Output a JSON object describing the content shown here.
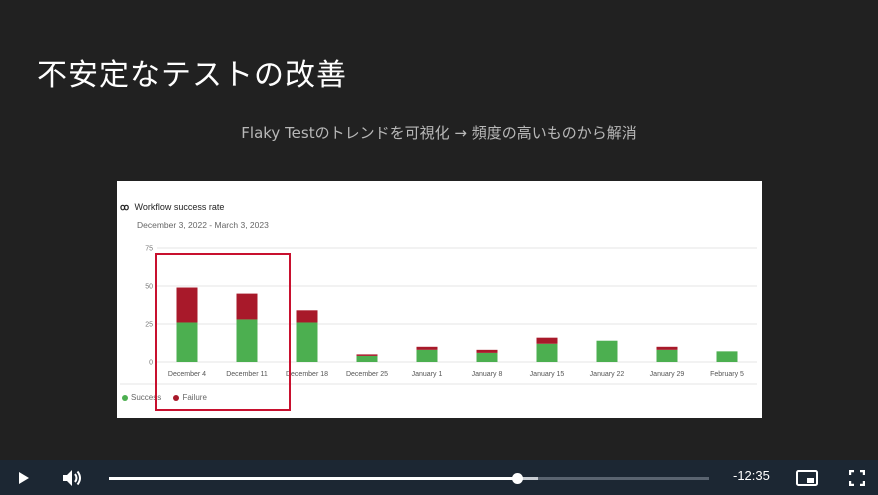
{
  "slide": {
    "title": "不安定なテストの改善",
    "subtitle": "Flaky Testのトレンドを可視化 → 頻度の高いものから解消"
  },
  "chart_header": {
    "logo": "ꝏ",
    "title": "Workflow success rate",
    "range": "December 3, 2022 - March 3, 2023"
  },
  "chart_data": {
    "type": "bar",
    "stacked": true,
    "title": "Workflow success rate",
    "categories": [
      "December 4",
      "December 11",
      "December 18",
      "December 25",
      "January 1",
      "January 8",
      "January 15",
      "January 22",
      "January 29",
      "February 5"
    ],
    "series": [
      {
        "name": "Success",
        "color": "#4caf50",
        "values": [
          26,
          28,
          26,
          4,
          8,
          6,
          12,
          14,
          8,
          7
        ]
      },
      {
        "name": "Failure",
        "color": "#a8192a",
        "values": [
          23,
          17,
          8,
          1,
          2,
          2,
          4,
          0,
          2,
          0
        ]
      }
    ],
    "yticks": [
      0,
      25,
      50,
      75
    ],
    "ylim": [
      0,
      75
    ],
    "grid": true,
    "legend_position": "bottom-left"
  },
  "legend": {
    "success_label": "Success",
    "failure_label": "Failure"
  },
  "player": {
    "time_remaining": "-12:35",
    "progress": 0.68,
    "buffered": 0.715,
    "icons": [
      "play-icon",
      "volume-icon",
      "picture-in-picture-icon",
      "fullscreen-icon"
    ]
  }
}
